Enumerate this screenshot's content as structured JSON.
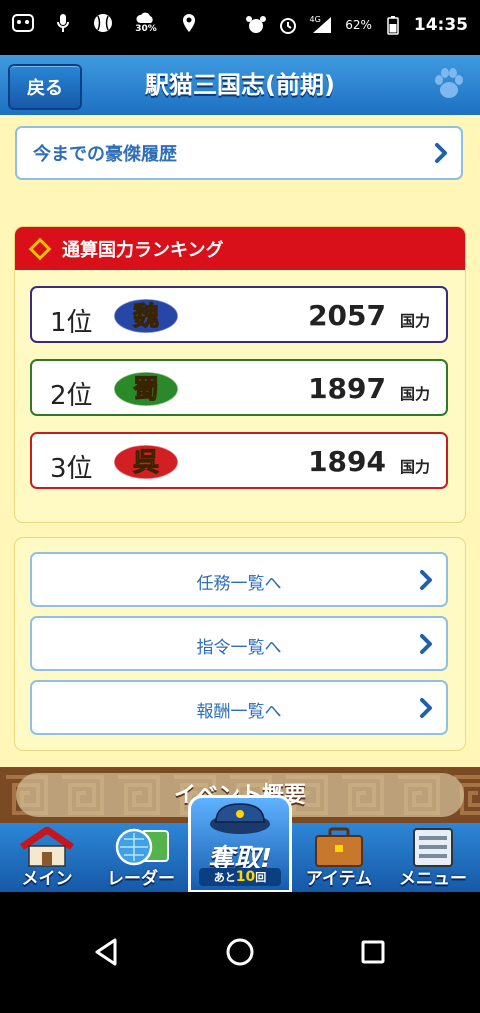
{
  "status_bar": {
    "weather": "30%",
    "network": "4G",
    "battery": "62%",
    "time": "14:35"
  },
  "header": {
    "back_label": "戻る",
    "title": "駅猫三国志(前期)",
    "paw_icon": "paw-icon"
  },
  "history": {
    "label": "今までの豪傑履歴"
  },
  "ranking": {
    "title": "通算国力ランキング",
    "unit": "国力",
    "entries": [
      {
        "rank": "1位",
        "faction": "魏",
        "score": "2057",
        "border": "#3a2a80",
        "emblem_color": "#2747a8"
      },
      {
        "rank": "2位",
        "faction": "蜀",
        "score": "1897",
        "border": "#2f7a2a",
        "emblem_color": "#2a8a2a"
      },
      {
        "rank": "3位",
        "faction": "呉",
        "score": "1894",
        "border": "#c61d22",
        "emblem_color": "#d21f24"
      }
    ]
  },
  "links": [
    {
      "label": "任務一覧へ"
    },
    {
      "label": "指令一覧へ"
    },
    {
      "label": "報酬一覧へ"
    }
  ],
  "event": {
    "label": "イベント概要"
  },
  "bottom_nav": {
    "items": [
      {
        "label": "メイン"
      },
      {
        "label": "レーダー"
      },
      {
        "label": "アイテム"
      },
      {
        "label": "メニュー"
      }
    ],
    "steal": {
      "label": "奪取!",
      "prefix": "あと",
      "count": "10",
      "suffix": "回"
    }
  }
}
